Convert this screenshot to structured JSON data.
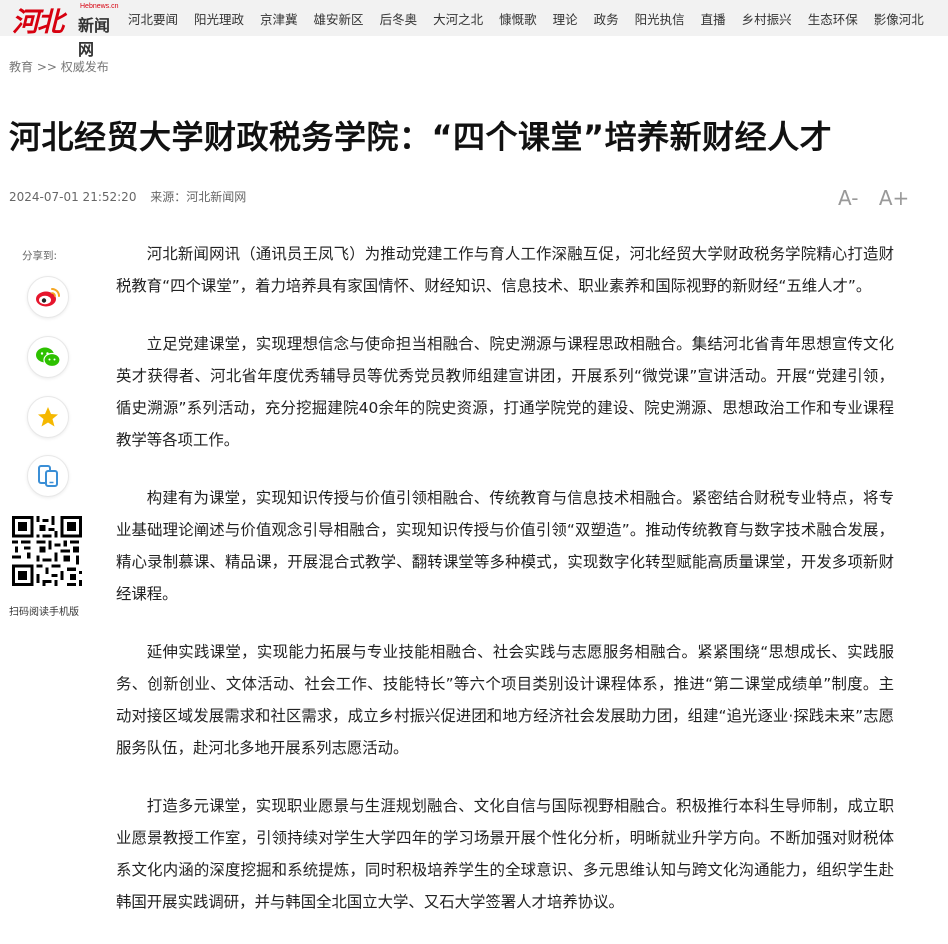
{
  "logo": {
    "mark": "河北",
    "domain": "Hebnews.cn",
    "name": "新闻网"
  },
  "nav": [
    "河北要闻",
    "阳光理政",
    "京津冀",
    "雄安新区",
    "后冬奥",
    "大河之北",
    "慷慨歌",
    "理论",
    "政务",
    "阳光执信",
    "直播",
    "乡村振兴",
    "生态环保",
    "影像河北"
  ],
  "breadcrumb": {
    "section": "教育",
    "sep": ">>",
    "sub": "权威发布"
  },
  "title": "河北经贸大学财政税务学院：“四个课堂”培养新财经人才",
  "meta": {
    "datetime": "2024-07-01 21:52:20",
    "source": "来源：河北新闻网"
  },
  "font_controls": {
    "smaller": "A-",
    "larger": "A+"
  },
  "share": {
    "label": "分享到:",
    "buttons": [
      "weibo-icon",
      "wechat-icon",
      "star-icon",
      "mobile-icon"
    ],
    "colors": {
      "weibo": "#e6162d",
      "wechat": "#2dc100",
      "star": "#f5b800",
      "mobile": "#3b8fd6"
    }
  },
  "qr_label": "扫码阅读手机版",
  "paragraphs": [
    "河北新闻网讯（通讯员王凤飞）为推动党建工作与育人工作深融互促，河北经贸大学财政税务学院精心打造财税教育“四个课堂”，着力培养具有家国情怀、财经知识、信息技术、职业素养和国际视野的新财经“五维人才”。",
    "立足党建课堂，实现理想信念与使命担当相融合、院史溯源与课程思政相融合。集结河北省青年思想宣传文化英才获得者、河北省年度优秀辅导员等优秀党员教师组建宣讲团，开展系列“微党课”宣讲活动。开展“党建引领，循史溯源”系列活动，充分挖掘建院40余年的院史资源，打通学院党的建设、院史溯源、思想政治工作和专业课程教学等各项工作。",
    "构建有为课堂，实现知识传授与价值引领相融合、传统教育与信息技术相融合。紧密结合财税专业特点，将专业基础理论阐述与价值观念引导相融合，实现知识传授与价值引领“双塑造”。推动传统教育与数字技术融合发展，精心录制慕课、精品课，开展混合式教学、翻转课堂等多种模式，实现数字化转型赋能高质量课堂，开发多项新财经课程。",
    "延伸实践课堂，实现能力拓展与专业技能相融合、社会实践与志愿服务相融合。紧紧围绕“思想成长、实践服务、创新创业、文体活动、社会工作、技能特长”等六个项目类别设计课程体系，推进“第二课堂成绩单”制度。主动对接区域发展需求和社区需求，成立乡村振兴促进团和地方经济社会发展助力团，组建“追光逐业·探践未来”志愿服务队伍，赴河北多地开展系列志愿活动。",
    "打造多元课堂，实现职业愿景与生涯规划融合、文化自信与国际视野相融合。积极推行本科生导师制，成立职业愿景教授工作室，引领持续对学生大学四年的学习场景开展个性化分析，明晰就业升学方向。不断加强对财税体系文化内涵的深度挖掘和系统提炼，同时积极培养学生的全球意识、多元思维认知与跨文化沟通能力，组织学生赴韩国开展实践调研，并与韩国全北国立大学、又石大学签署人才培养协议。"
  ]
}
